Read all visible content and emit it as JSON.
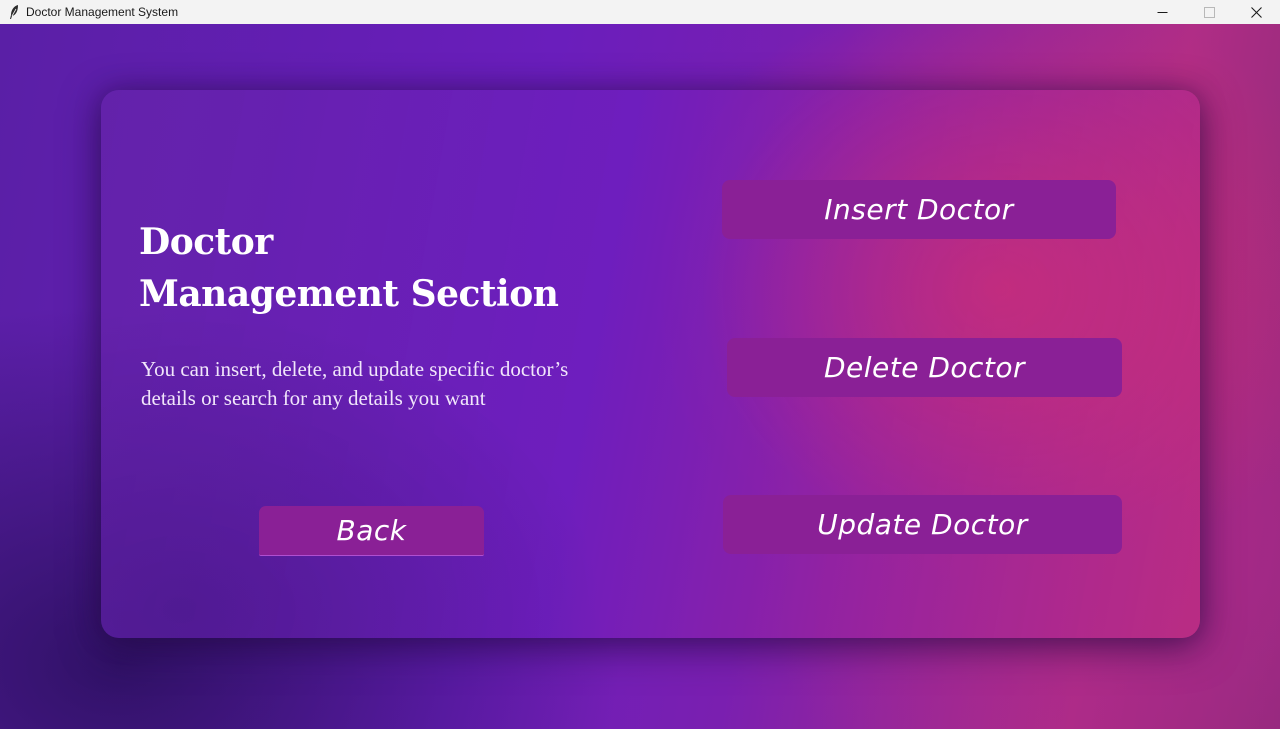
{
  "window": {
    "title": "Doctor Management System",
    "icon": "feather-icon",
    "controls": [
      "minimize-icon",
      "maximize-icon",
      "close-icon"
    ]
  },
  "main": {
    "heading_line1": "Doctor",
    "heading_line2": "Management Section",
    "description": "You can insert, delete, and update specific doctor’s details or search for any details you want",
    "buttons": {
      "insert": "Insert Doctor",
      "delete": "Delete Doctor",
      "update": "Update Doctor",
      "back": "Back"
    }
  },
  "colors": {
    "button_bg": "#8a2096",
    "accent_pink": "#cd2d73",
    "accent_purple": "#6a1ebc"
  }
}
